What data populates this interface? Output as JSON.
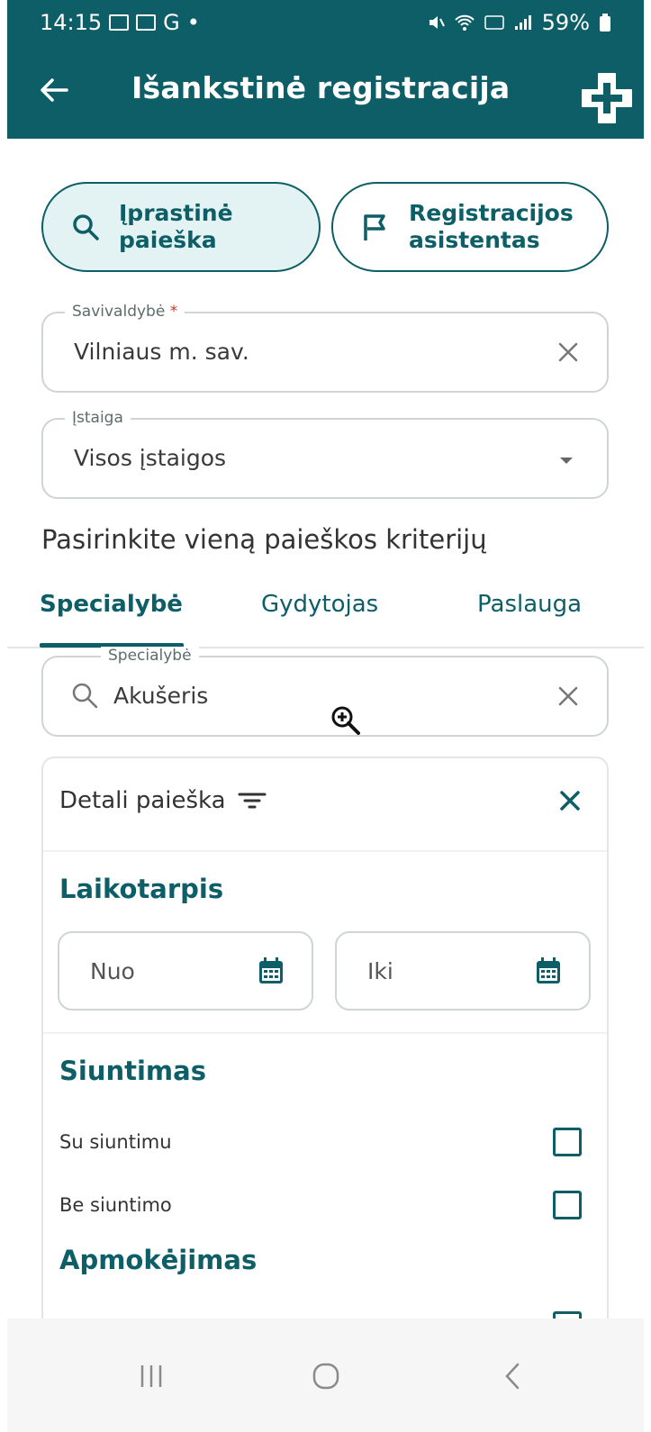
{
  "statusbar": {
    "time": "14:15",
    "letter": "G",
    "dot": "•",
    "battery": "59%"
  },
  "appbar": {
    "title": "Išankstinė registracija"
  },
  "modes": [
    {
      "label_line1": "Įprastinė",
      "label_line2": "paieška",
      "active": true
    },
    {
      "label_line1": "Registracijos",
      "label_line2": "asistentas",
      "active": false
    }
  ],
  "municipality": {
    "label": "Savivaldybė",
    "required_mark": "*",
    "value": "Vilniaus m. sav."
  },
  "institution": {
    "label": "Įstaiga",
    "value": "Visos įstaigos"
  },
  "criteria_prompt": "Pasirinkite vieną paieškos kriterijų",
  "tabs": [
    {
      "label": "Specialybė",
      "active": true
    },
    {
      "label": "Gydytojas",
      "active": false
    },
    {
      "label": "Paslauga",
      "active": false
    }
  ],
  "specialty": {
    "label": "Specialybė",
    "value": "Akušeris"
  },
  "details": {
    "title": "Detali paieška",
    "period": {
      "heading": "Laikotarpis",
      "from": "Nuo",
      "to": "Iki"
    },
    "referral": {
      "heading": "Siuntimas",
      "options": [
        "Su siuntimu",
        "Be siuntimo"
      ]
    },
    "payment": {
      "heading": "Apmokėjimas"
    }
  },
  "colors": {
    "primary": "#0d5e66",
    "active_chip": "#e3f3f3",
    "required": "#c0392b"
  }
}
